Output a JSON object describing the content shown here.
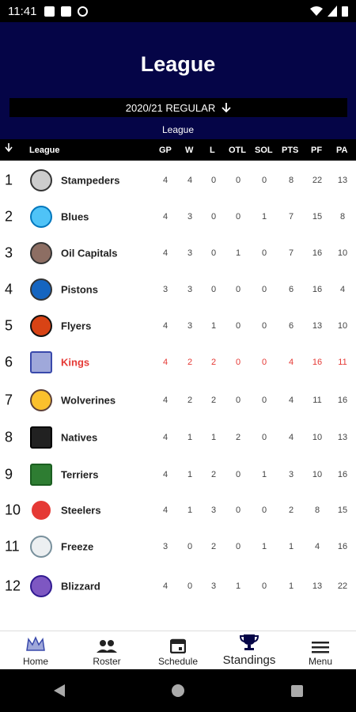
{
  "status_bar": {
    "time": "11:41"
  },
  "header": {
    "title": "League",
    "season_label": "2020/21 REGULAR",
    "subtitle": "League"
  },
  "table": {
    "columns": {
      "league": "League",
      "gp": "GP",
      "w": "W",
      "l": "L",
      "otl": "OTL",
      "sol": "SOL",
      "pts": "PTS",
      "pf": "PF",
      "pa": "PA"
    },
    "rows": [
      {
        "rank": "1",
        "team": "Stampeders",
        "gp": "4",
        "w": "4",
        "l": "0",
        "otl": "0",
        "sol": "0",
        "pts": "8",
        "pf": "22",
        "pa": "13"
      },
      {
        "rank": "2",
        "team": "Blues",
        "gp": "4",
        "w": "3",
        "l": "0",
        "otl": "0",
        "sol": "1",
        "pts": "7",
        "pf": "15",
        "pa": "8"
      },
      {
        "rank": "3",
        "team": "Oil Capitals",
        "gp": "4",
        "w": "3",
        "l": "0",
        "otl": "1",
        "sol": "0",
        "pts": "7",
        "pf": "16",
        "pa": "10"
      },
      {
        "rank": "4",
        "team": "Pistons",
        "gp": "3",
        "w": "3",
        "l": "0",
        "otl": "0",
        "sol": "0",
        "pts": "6",
        "pf": "16",
        "pa": "4"
      },
      {
        "rank": "5",
        "team": "Flyers",
        "gp": "4",
        "w": "3",
        "l": "1",
        "otl": "0",
        "sol": "0",
        "pts": "6",
        "pf": "13",
        "pa": "10"
      },
      {
        "rank": "6",
        "team": "Kings",
        "gp": "4",
        "w": "2",
        "l": "2",
        "otl": "0",
        "sol": "0",
        "pts": "4",
        "pf": "16",
        "pa": "11"
      },
      {
        "rank": "7",
        "team": "Wolverines",
        "gp": "4",
        "w": "2",
        "l": "2",
        "otl": "0",
        "sol": "0",
        "pts": "4",
        "pf": "11",
        "pa": "16"
      },
      {
        "rank": "8",
        "team": "Natives",
        "gp": "4",
        "w": "1",
        "l": "1",
        "otl": "2",
        "sol": "0",
        "pts": "4",
        "pf": "10",
        "pa": "13"
      },
      {
        "rank": "9",
        "team": "Terriers",
        "gp": "4",
        "w": "1",
        "l": "2",
        "otl": "0",
        "sol": "1",
        "pts": "3",
        "pf": "10",
        "pa": "16"
      },
      {
        "rank": "10",
        "team": "Steelers",
        "gp": "4",
        "w": "1",
        "l": "3",
        "otl": "0",
        "sol": "0",
        "pts": "2",
        "pf": "8",
        "pa": "15"
      },
      {
        "rank": "11",
        "team": "Freeze",
        "gp": "3",
        "w": "0",
        "l": "2",
        "otl": "0",
        "sol": "1",
        "pts": "1",
        "pf": "4",
        "pa": "16"
      },
      {
        "rank": "12",
        "team": "Blizzard",
        "gp": "4",
        "w": "0",
        "l": "3",
        "otl": "1",
        "sol": "0",
        "pts": "1",
        "pf": "13",
        "pa": "22"
      }
    ],
    "highlight_color": "#e53935"
  },
  "bottom_nav": {
    "items": [
      {
        "label": "Home",
        "icon": "crown-logo-icon"
      },
      {
        "label": "Roster",
        "icon": "people-icon"
      },
      {
        "label": "Schedule",
        "icon": "calendar-icon"
      },
      {
        "label": "Standings",
        "icon": "trophy-icon"
      },
      {
        "label": "Menu",
        "icon": "menu-icon"
      }
    ]
  },
  "colors": {
    "header_bg": "#050547",
    "table_head_bg": "#000000",
    "highlight": "#e53935"
  }
}
